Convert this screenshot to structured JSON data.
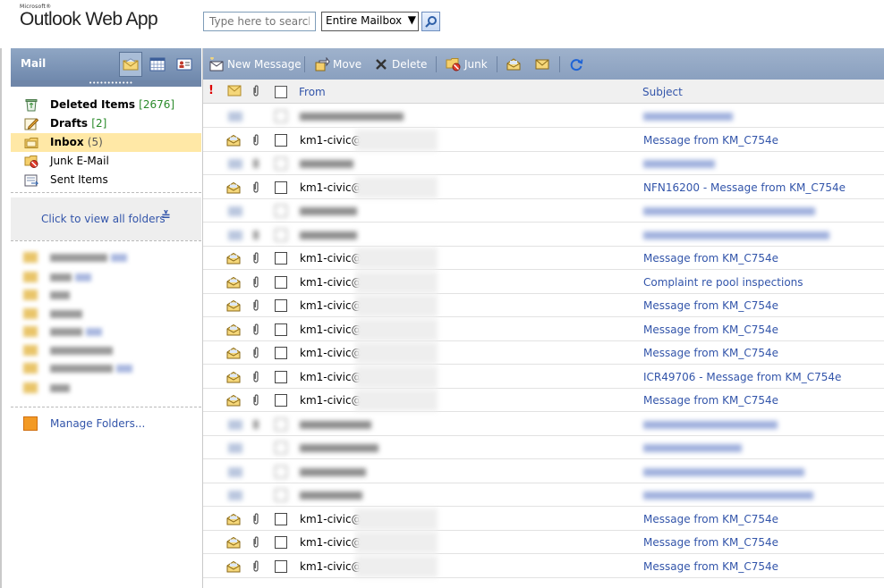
{
  "header": {
    "brand_small": "Microsoft®",
    "brand": "Outlook Web App",
    "search_placeholder": "Type here to search",
    "scope": "Entire Mailbox",
    "search_icon": "magnifier-icon"
  },
  "sidebar": {
    "title": "Mail",
    "folders": [
      {
        "label": "Deleted Items",
        "count": "[2676]",
        "icon": "recycle-bin-icon"
      },
      {
        "label": "Drafts",
        "count": "[2]",
        "icon": "drafts-icon"
      },
      {
        "label": "Inbox",
        "count": "(5)",
        "icon": "inbox-folder-icon"
      },
      {
        "label": "Junk E-Mail",
        "count": "",
        "icon": "junk-folder-icon"
      },
      {
        "label": "Sent Items",
        "count": "",
        "icon": "sent-items-icon"
      }
    ],
    "view_all": "Click to view all folders",
    "manage_folders": "Manage Folders..."
  },
  "toolbar": {
    "new_message": "New Message",
    "move": "Move",
    "delete": "Delete",
    "junk": "Junk"
  },
  "columns": {
    "from": "From",
    "subject": "Subject"
  },
  "messages": [
    {
      "from": "",
      "subject": "",
      "blurred": true
    },
    {
      "from": "km1-civic@",
      "subject": "Message from KM_C754e"
    },
    {
      "from": "",
      "subject": "",
      "blurred": true
    },
    {
      "from": "km1-civic@",
      "subject": "NFN16200 - Message from KM_C754e"
    },
    {
      "from": "",
      "subject": "",
      "blurred": true
    },
    {
      "from": "",
      "subject": "",
      "blurred": true
    },
    {
      "from": "km1-civic@",
      "subject": "Message from KM_C754e"
    },
    {
      "from": "km1-civic@",
      "subject": "Complaint re pool inspections"
    },
    {
      "from": "km1-civic@",
      "subject": "Message from KM_C754e"
    },
    {
      "from": "km1-civic@",
      "subject": "Message from KM_C754e"
    },
    {
      "from": "km1-civic@",
      "subject": "Message from KM_C754e"
    },
    {
      "from": "km1-civic@",
      "subject": "ICR49706 - Message from KM_C754e"
    },
    {
      "from": "km1-civic@",
      "subject": "Message from KM_C754e"
    },
    {
      "from": "",
      "subject": "",
      "blurred": true
    },
    {
      "from": "",
      "subject": "",
      "blurred": true
    },
    {
      "from": "",
      "subject": "",
      "blurred": true
    },
    {
      "from": "",
      "subject": "",
      "blurred": true
    },
    {
      "from": "km1-civic@",
      "subject": "Message from KM_C754e"
    },
    {
      "from": "km1-civic@",
      "subject": "Message from KM_C754e"
    },
    {
      "from": "km1-civic@",
      "subject": "Message from KM_C754e"
    }
  ],
  "colors": {
    "toolbar": "#8aa0bf",
    "selected_folder": "#ffe8a6",
    "link": "#3355aa"
  }
}
